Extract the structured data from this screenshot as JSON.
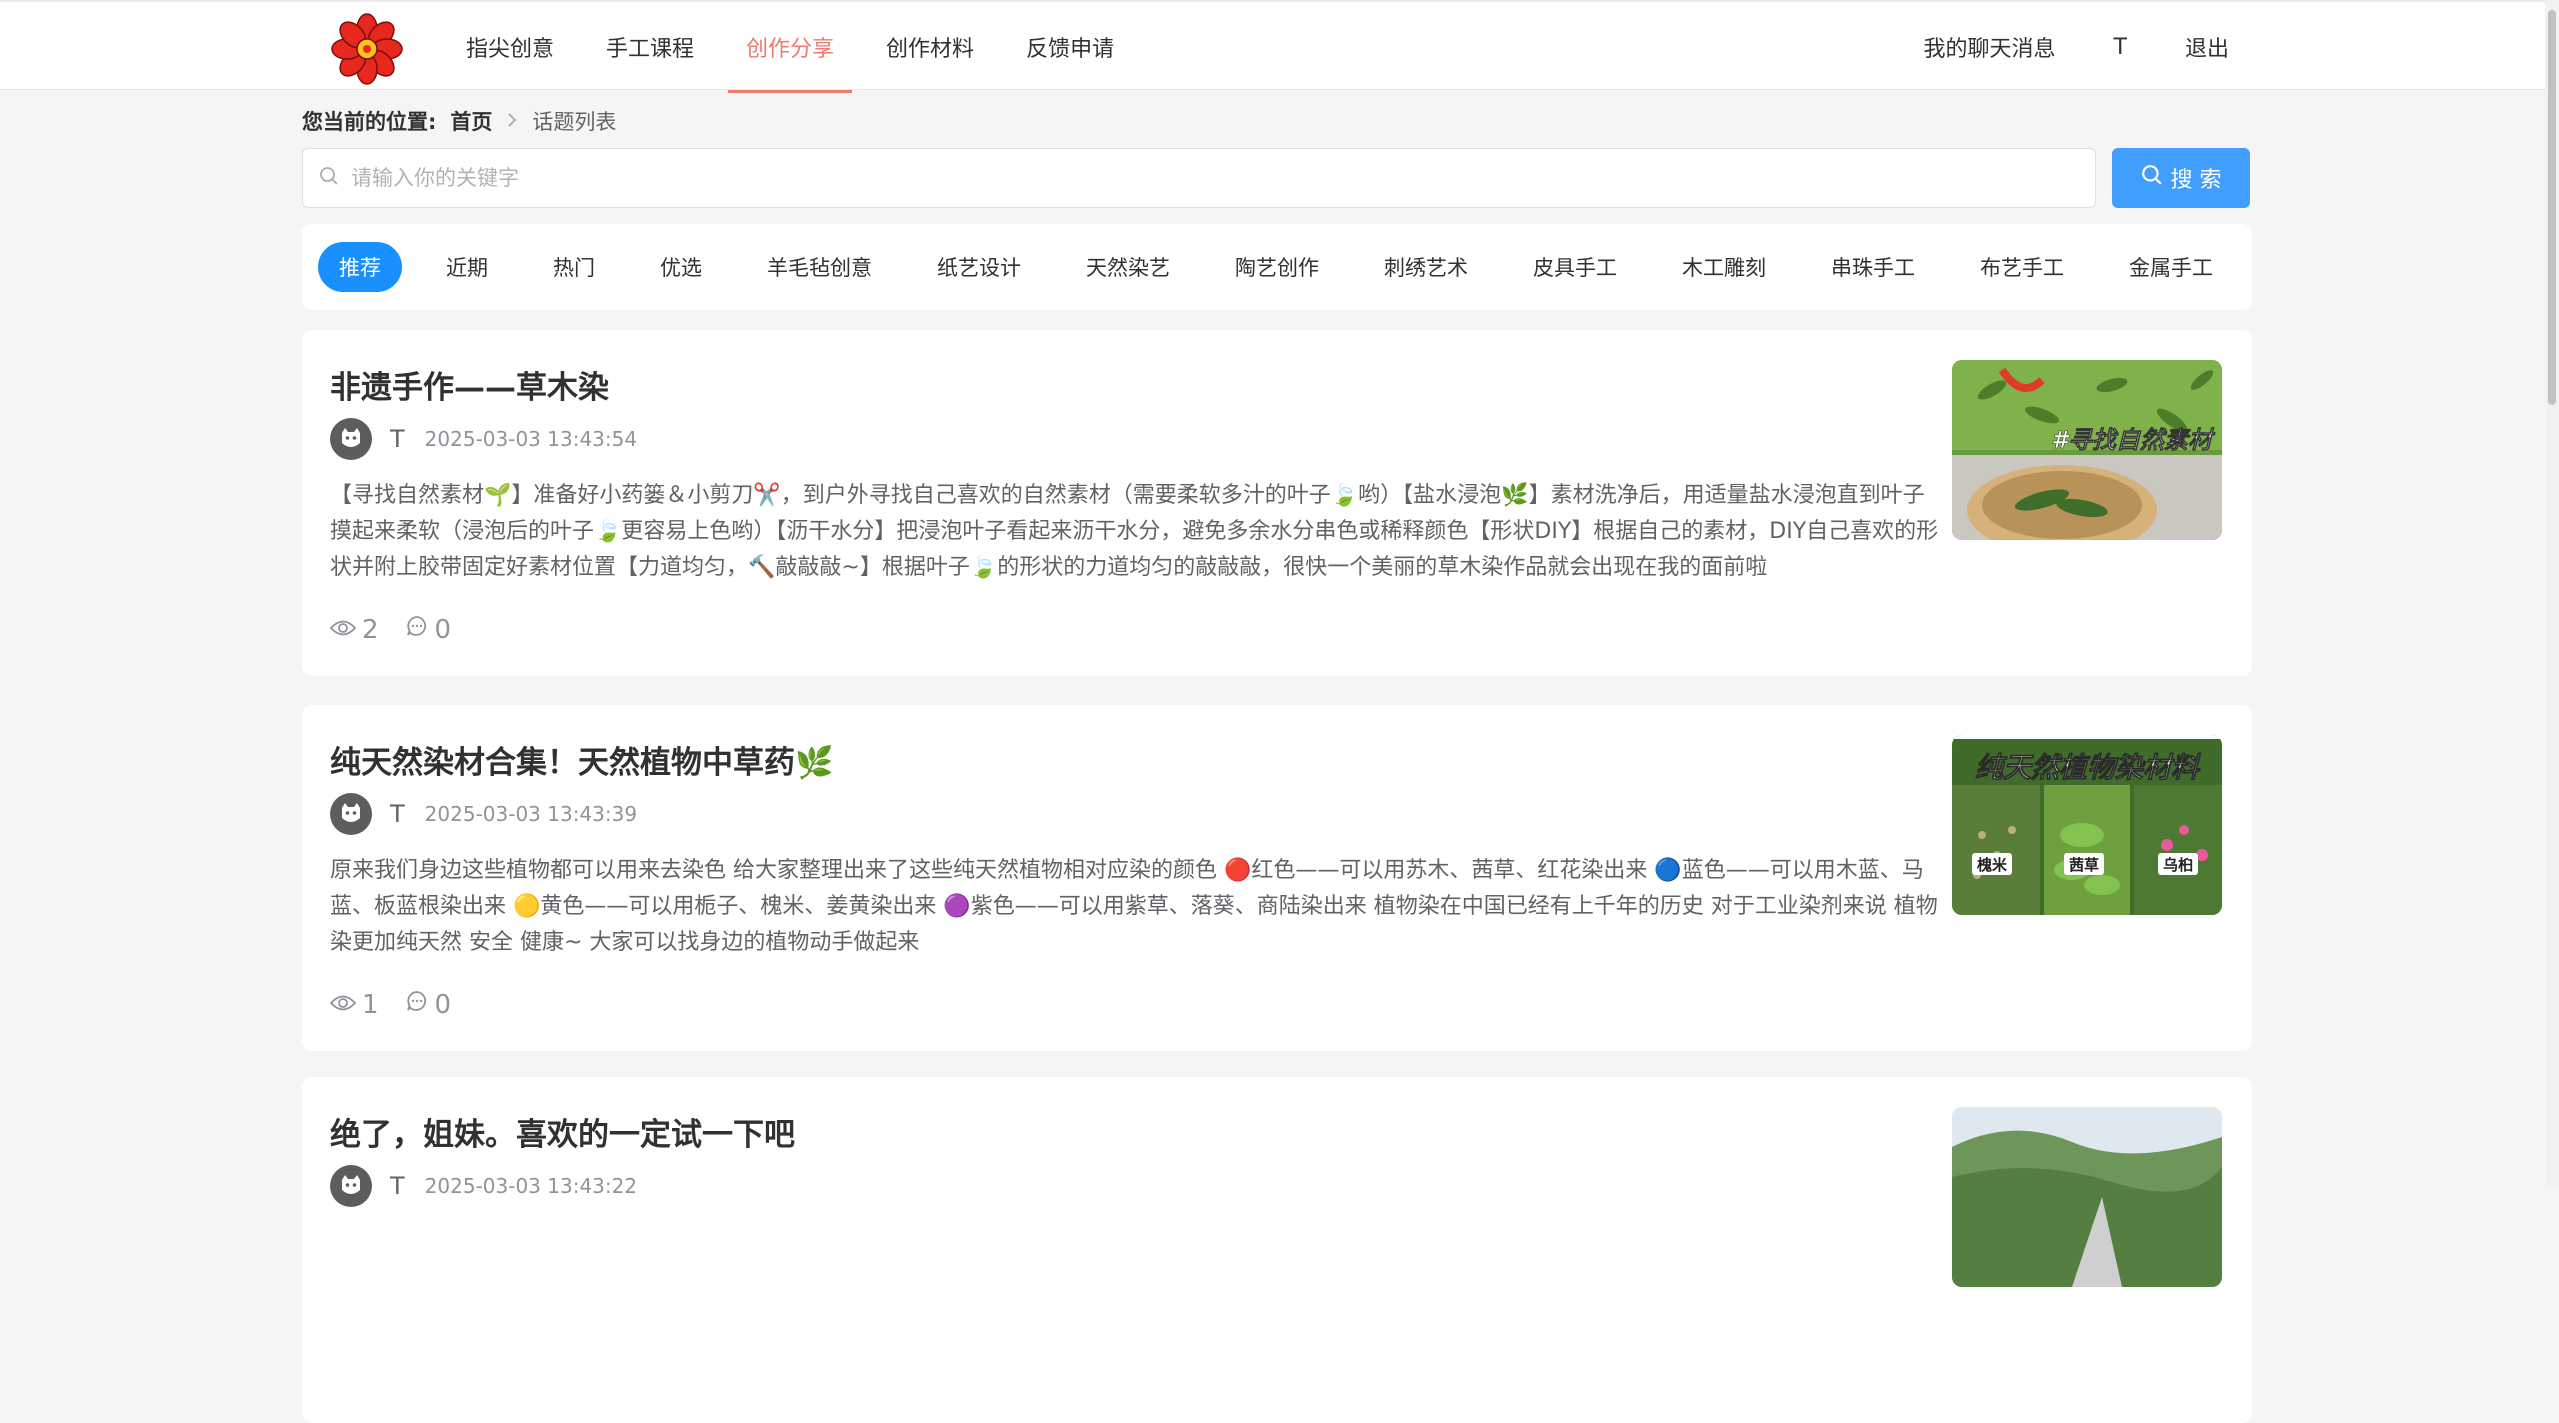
{
  "nav": {
    "items": [
      "指尖创意",
      "手工课程",
      "创作分享",
      "创作材料",
      "反馈申请"
    ],
    "active_index": 2,
    "right": {
      "messages": "我的聊天消息",
      "user": "T",
      "logout": "退出"
    }
  },
  "breadcrumb": {
    "label": "您当前的位置:",
    "home": "首页",
    "current": "话题列表"
  },
  "search": {
    "placeholder": "请输入你的关键字",
    "button": "搜 索"
  },
  "tabs": [
    "推荐",
    "近期",
    "热门",
    "优选",
    "羊毛毡创意",
    "纸艺设计",
    "天然染艺",
    "陶艺创作",
    "刺绣艺术",
    "皮具手工",
    "木工雕刻",
    "串珠手工",
    "布艺手工",
    "金属手工"
  ],
  "posts": [
    {
      "title": "非遗手作——草木染",
      "author": "T",
      "time": "2025-03-03 13:43:54",
      "excerpt": "【寻找自然素材🌱】准备好小药篓＆小剪刀✂️，到户外寻找自己喜欢的自然素材（需要柔软多汁的叶子🍃哟）【盐水浸泡🌿】素材洗净后，用适量盐水浸泡直到叶子摸起来柔软（浸泡后的叶子🍃更容易上色哟）【沥干水分】把浸泡叶子看起来沥干水分，避免多余水分串色或稀释颜色【形状DIY】根据自己的素材，DIY自己喜欢的形状并附上胶带固定好素材位置【力道均匀，🔨敲敲敲~】根据叶子🍃的形状的力道均匀的敲敲敲，很快一个美丽的草木染作品就会出现在我的面前啦",
      "views": "2",
      "comments": "0",
      "image_caption": "#寻找自然素材"
    },
    {
      "title": "纯天然染材合集！天然植物中草药🌿",
      "author": "T",
      "time": "2025-03-03 13:43:39",
      "excerpt": "原来我们身边这些植物都可以用来去染色 给大家整理出来了这些纯天然植物相对应染的颜色 🔴红色——可以用苏木、茜草、红花染出来 🔵蓝色——可以用木蓝、马蓝、板蓝根染出来 🟡黄色——可以用栀子、槐米、姜黄染出来 🟣紫色——可以用紫草、落葵、商陆染出来 植物染在中国已经有上千年的历史 对于工业染剂来说 植物染更加纯天然 安全 健康~ 大家可以找身边的植物动手做起来",
      "views": "1",
      "comments": "0",
      "image_caption": "纯天然植物染材料",
      "image_labels": [
        "槐米",
        "茜草",
        "乌桕"
      ]
    },
    {
      "title": "绝了，姐妹。喜欢的一定试一下吧",
      "author": "T",
      "time": "2025-03-03 13:43:22"
    }
  ],
  "colors": {
    "accent": "#ee7b6d",
    "primary": "#1890ff",
    "button": "#409eff"
  }
}
